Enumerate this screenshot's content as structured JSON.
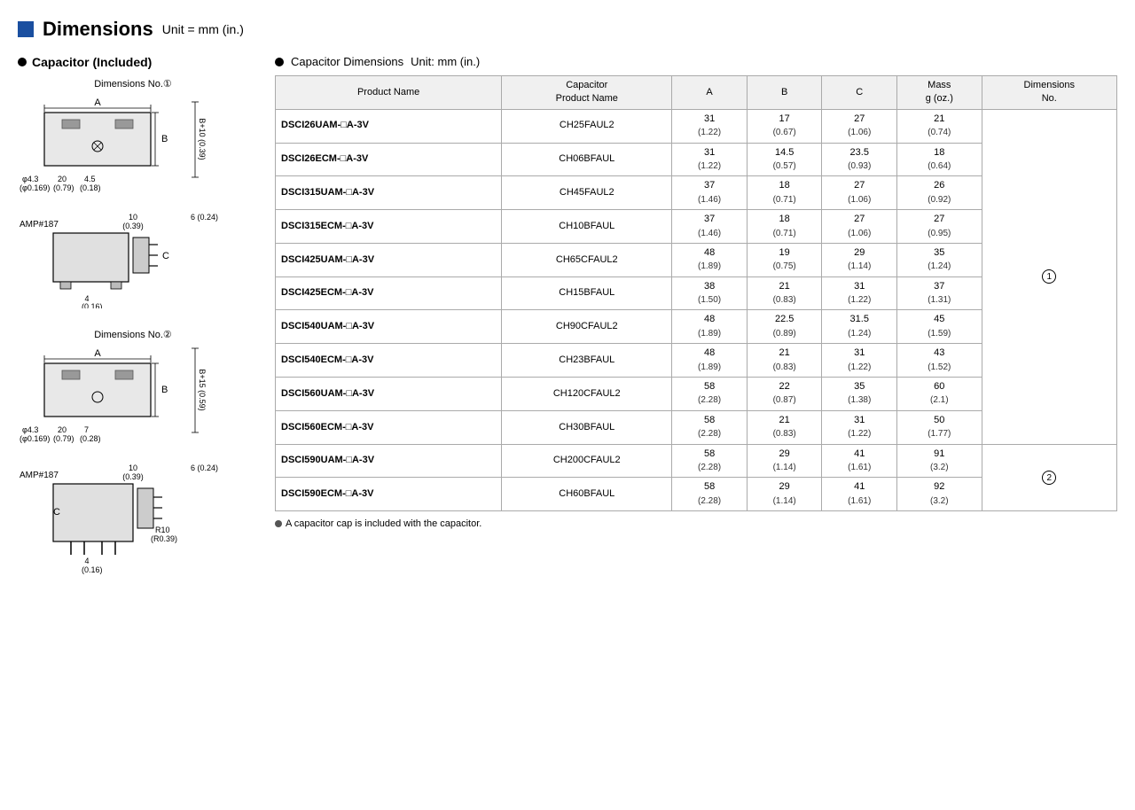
{
  "page": {
    "title": "Dimensions",
    "title_unit": "Unit = mm (in.)",
    "left_heading": "Capacitor (Included)",
    "dim_no1_label": "Dimensions No.①",
    "dim_no2_label": "Dimensions No.②",
    "cap_dim_heading": "Capacitor Dimensions",
    "cap_dim_unit": "Unit: mm (in.)",
    "footnote": "A capacitor cap is included with the capacitor."
  },
  "table": {
    "headers": {
      "product_name": "Product Name",
      "cap_product_name": "Capacitor Product Name",
      "a": "A",
      "b": "B",
      "c": "C",
      "mass": "Mass g (oz.)",
      "dim_no": "Dimensions No."
    },
    "rows": [
      {
        "product": "DSCI26UAM-□A-3V",
        "cap": "CH25FAUL2",
        "a": "31",
        "a_sub": "(1.22)",
        "b": "17",
        "b_sub": "(0.67)",
        "c": "27",
        "c_sub": "(1.06)",
        "mass": "21",
        "mass_sub": "(0.74)",
        "dim_no": "1",
        "dim_no_span": 10
      },
      {
        "product": "DSCI26ECM-□A-3V",
        "cap": "CH06BFAUL",
        "a": "31",
        "a_sub": "(1.22)",
        "b": "14.5",
        "b_sub": "(0.57)",
        "c": "23.5",
        "c_sub": "(0.93)",
        "mass": "18",
        "mass_sub": "(0.64)",
        "dim_no": null
      },
      {
        "product": "DSCI315UAM-□A-3V",
        "cap": "CH45FAUL2",
        "a": "37",
        "a_sub": "(1.46)",
        "b": "18",
        "b_sub": "(0.71)",
        "c": "27",
        "c_sub": "(1.06)",
        "mass": "26",
        "mass_sub": "(0.92)",
        "dim_no": null
      },
      {
        "product": "DSCI315ECM-□A-3V",
        "cap": "CH10BFAUL",
        "a": "37",
        "a_sub": "(1.46)",
        "b": "18",
        "b_sub": "(0.71)",
        "c": "27",
        "c_sub": "(1.06)",
        "mass": "27",
        "mass_sub": "(0.95)",
        "dim_no": null
      },
      {
        "product": "DSCI425UAM-□A-3V",
        "cap": "CH65CFAUL2",
        "a": "48",
        "a_sub": "(1.89)",
        "b": "19",
        "b_sub": "(0.75)",
        "c": "29",
        "c_sub": "(1.14)",
        "mass": "35",
        "mass_sub": "(1.24)",
        "dim_no": null
      },
      {
        "product": "DSCI425ECM-□A-3V",
        "cap": "CH15BFAUL",
        "a": "38",
        "a_sub": "(1.50)",
        "b": "21",
        "b_sub": "(0.83)",
        "c": "31",
        "c_sub": "(1.22)",
        "mass": "37",
        "mass_sub": "(1.31)",
        "dim_no": null
      },
      {
        "product": "DSCI540UAM-□A-3V",
        "cap": "CH90CFAUL2",
        "a": "48",
        "a_sub": "(1.89)",
        "b": "22.5",
        "b_sub": "(0.89)",
        "c": "31.5",
        "c_sub": "(1.24)",
        "mass": "45",
        "mass_sub": "(1.59)",
        "dim_no": null
      },
      {
        "product": "DSCI540ECM-□A-3V",
        "cap": "CH23BFAUL",
        "a": "48",
        "a_sub": "(1.89)",
        "b": "21",
        "b_sub": "(0.83)",
        "c": "31",
        "c_sub": "(1.22)",
        "mass": "43",
        "mass_sub": "(1.52)",
        "dim_no": null
      },
      {
        "product": "DSCI560UAM-□A-3V",
        "cap": "CH120CFAUL2",
        "a": "58",
        "a_sub": "(2.28)",
        "b": "22",
        "b_sub": "(0.87)",
        "c": "35",
        "c_sub": "(1.38)",
        "mass": "60",
        "mass_sub": "(2.1)",
        "dim_no": null
      },
      {
        "product": "DSCI560ECM-□A-3V",
        "cap": "CH30BFAUL",
        "a": "58",
        "a_sub": "(2.28)",
        "b": "21",
        "b_sub": "(0.83)",
        "c": "31",
        "c_sub": "(1.22)",
        "mass": "50",
        "mass_sub": "(1.77)",
        "dim_no": null
      },
      {
        "product": "DSCI590UAM-□A-3V",
        "cap": "CH200CFAUL2",
        "a": "58",
        "a_sub": "(2.28)",
        "b": "29",
        "b_sub": "(1.14)",
        "c": "41",
        "c_sub": "(1.61)",
        "mass": "91",
        "mass_sub": "(3.2)",
        "dim_no": "2",
        "dim_no_span": 2
      },
      {
        "product": "DSCI590ECM-□A-3V",
        "cap": "CH60BFAUL",
        "a": "58",
        "a_sub": "(2.28)",
        "b": "29",
        "b_sub": "(1.14)",
        "c": "41",
        "c_sub": "(1.61)",
        "mass": "92",
        "mass_sub": "(3.2)",
        "dim_no": null
      }
    ]
  }
}
